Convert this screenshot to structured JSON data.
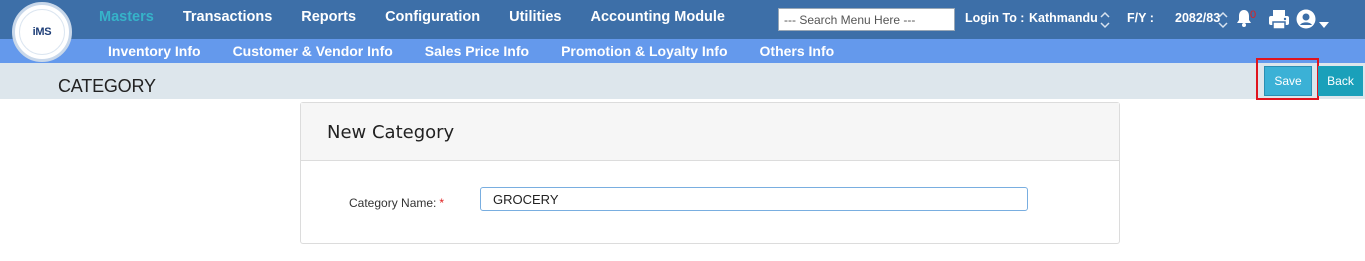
{
  "logo": {
    "text": "iMS"
  },
  "nav": {
    "items": [
      {
        "label": "Masters",
        "active": true
      },
      {
        "label": "Transactions"
      },
      {
        "label": "Reports"
      },
      {
        "label": "Configuration"
      },
      {
        "label": "Utilities"
      },
      {
        "label": "Accounting Module"
      }
    ],
    "search_placeholder": "--- Search Menu Here ---",
    "login_label": "Login To :",
    "login_value": "Kathmandu",
    "fy_label": "F/Y :",
    "fy_value": "2082/83",
    "notification_count": "0",
    "icons": [
      "bell-icon",
      "printer-icon",
      "user-icon",
      "caret-down-icon",
      "updown-icon"
    ]
  },
  "subnav": {
    "items": [
      {
        "label": "Inventory Info"
      },
      {
        "label": "Customer & Vendor Info"
      },
      {
        "label": "Sales Price Info"
      },
      {
        "label": "Promotion & Loyalty Info"
      },
      {
        "label": "Others Info"
      }
    ]
  },
  "page": {
    "title": "CATEGORY",
    "save_label": "Save",
    "back_label": "Back"
  },
  "form": {
    "card_title": "New Category",
    "category_name_label": "Category Name:",
    "required_mark": "*",
    "category_name_value": "GROCERY"
  },
  "colors": {
    "topbar": "#3d6fa8",
    "subbar": "#6499ec",
    "active_menu": "#36b3c9",
    "save_button": "#3bb1d6",
    "back_button": "#1aa0ba",
    "highlight": "#e0141e"
  }
}
